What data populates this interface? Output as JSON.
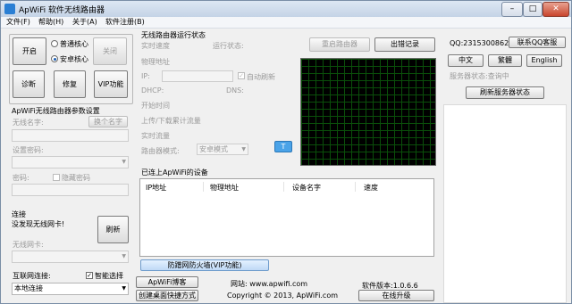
{
  "window": {
    "title": "ApWiFi 软件无线路由器",
    "min": "–",
    "max": "□",
    "close": "✕"
  },
  "menu": [
    "文件(F)",
    "帮助(H)",
    "关于(A)",
    "软件注册(B)"
  ],
  "control": {
    "start": "开启",
    "close": "关闭",
    "mode_normal": "普通核心",
    "mode_android": "安卓核心",
    "diagnose": "诊断",
    "repair": "修复",
    "vip": "VIP功能"
  },
  "params": {
    "title": "ApWiFi无线路由器参数设置",
    "ssid_label": "无线名字:",
    "change_name": "换个名字",
    "pwd_label": "设置密码:",
    "pwd2_label": "密码:",
    "hide_pwd": "隐藏密码"
  },
  "connection": {
    "title": "连接",
    "status": "没发现无线网卡!",
    "card_label": "无线网卡:",
    "refresh": "刷新",
    "internet_label": "互联网连接:",
    "smart_select": "智能选择",
    "local_conn": "本地连接"
  },
  "status": {
    "title": "无线路由器运行状态",
    "restart": "重启路由器",
    "share": "出错记录",
    "realtime_speed": "实时速度",
    "run_status": "运行状态:",
    "mac": "物理地址",
    "ip": "IP:",
    "auto_refresh": "自动刷新",
    "dhcp": "DHCP:",
    "dns": "DNS:",
    "start_time": "开始时间",
    "traffic": "上传/下载累计流量",
    "rt_traffic": "实时流量",
    "router_mode": "路由器模式:",
    "mode_value": "安卓模式",
    "t_button": "T"
  },
  "devices": {
    "title": "已连上ApWiFi的设备",
    "columns": [
      "IP地址",
      "物理地址",
      "设备名字",
      "速度"
    ],
    "firewall": "防蹭网防火墙(VIP功能)"
  },
  "footer": {
    "blog": "ApWiFi博客",
    "shortcut": "创建桌面快捷方式",
    "website": "网站: www.apwifi.com",
    "copyright": "Copyright © 2013, ApWiFi.com",
    "version": "软件版本:1.0.6.6",
    "upgrade": "在线升级"
  },
  "right": {
    "qq": "QQ:2315300862",
    "contact_qq": "联系QQ客服",
    "chinese": "中文",
    "traditional": "繁體",
    "english": "English",
    "server_status": "服务器状态:查询中",
    "refresh_server": "刷新服务器状态"
  }
}
